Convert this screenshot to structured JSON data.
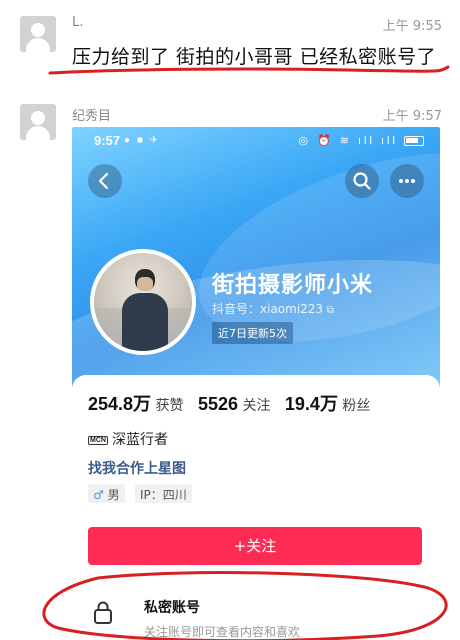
{
  "messages": [
    {
      "sender": "L.",
      "time": "上午 9:55",
      "text": "压力给到了 街拍的小哥哥  已经私密账号了"
    },
    {
      "sender": "纪秀目",
      "time": "上午 9:57"
    }
  ],
  "screenshot": {
    "status_time": "9:57",
    "profile": {
      "nickname": "街拍摄影师小米",
      "douyin_id": "抖音号：xiaomi223",
      "update_badge": "近7日更新5次",
      "stats": [
        {
          "value": "254.8万",
          "label": "获赞"
        },
        {
          "value": "5526",
          "label": "关注"
        },
        {
          "value": "19.4万",
          "label": "粉丝"
        }
      ],
      "mcn_icon": "MCN",
      "mcn": "深蓝行者",
      "star_link": "找我合作上星图",
      "gender_symbol": "♂",
      "gender": "男",
      "ip": "IP：四川",
      "follow_button": "+关注",
      "private_title": "私密账号",
      "private_sub": "关注账号即可查看内容和喜欢"
    }
  },
  "colors": {
    "follow": "#fe2c55",
    "annotation": "#d92020",
    "banner": "#3aa7f5"
  },
  "icons": [
    "default-avatar-icon",
    "back-icon",
    "search-icon",
    "more-icon",
    "lock-icon",
    "copy-icon"
  ]
}
